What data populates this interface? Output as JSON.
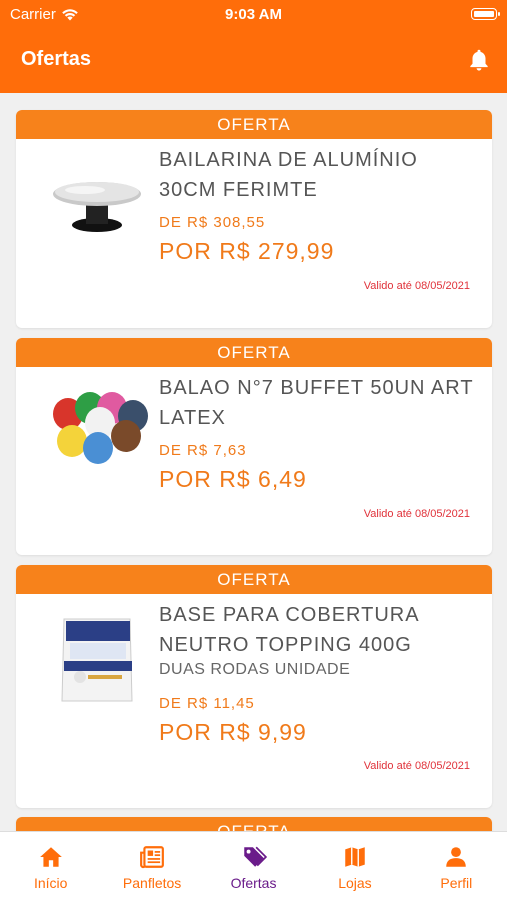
{
  "status": {
    "carrier": "Carrier",
    "time": "9:03 AM"
  },
  "header": {
    "title": "Ofertas",
    "bell_icon": "bell-icon"
  },
  "offers": [
    {
      "badge": "OFERTA",
      "name": "BAILARINA DE ALUMÍNIO 30CM FERIMTE",
      "subtitle": "",
      "old_price": "DE R$ 308,55",
      "new_price": "POR R$ 279,99",
      "valid": "Valido até 08/05/2021"
    },
    {
      "badge": "OFERTA",
      "name": "BALAO N°7 BUFFET 50UN ART LATEX",
      "subtitle": "",
      "old_price": "DE R$ 7,63",
      "new_price": "POR R$ 6,49",
      "valid": "Valido até 08/05/2021"
    },
    {
      "badge": "OFERTA",
      "name": "BASE PARA COBERTURA NEUTRO TOPPING 400G",
      "subtitle": "DUAS RODAS UNIDADE",
      "old_price": "DE R$ 11,45",
      "new_price": "POR R$ 9,99",
      "valid": "Valido até 08/05/2021"
    },
    {
      "badge": "OFERTA"
    }
  ],
  "tabs": [
    {
      "label": "Início",
      "icon": "home-icon"
    },
    {
      "label": "Panfletos",
      "icon": "newspaper-icon"
    },
    {
      "label": "Ofertas",
      "icon": "tag-icon",
      "active": true
    },
    {
      "label": "Lojas",
      "icon": "map-icon"
    },
    {
      "label": "Perfil",
      "icon": "user-icon"
    }
  ],
  "colors": {
    "primary": "#ff6d0a",
    "badge": "#f7821b",
    "price": "#f07a1a",
    "valid": "#e0323a",
    "active_tab": "#6a1b8a"
  }
}
